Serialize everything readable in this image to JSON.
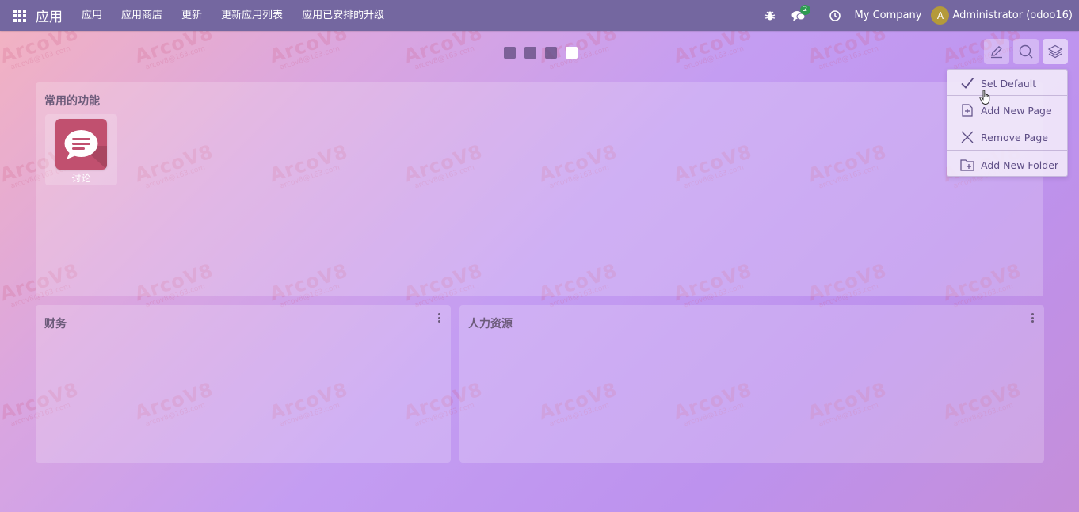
{
  "navbar": {
    "brand": "应用",
    "menu": [
      "应用",
      "应用商店",
      "更新",
      "更新应用列表",
      "应用已安排的升级"
    ],
    "messages_badge": "2",
    "company": "My Company",
    "user_initial": "A",
    "user_name": "Administrator (odoo16)"
  },
  "pager": {
    "count": 4,
    "active_index": 3
  },
  "dropdown": {
    "items": [
      {
        "label": "Set Default",
        "icon": "check-icon"
      },
      {
        "label": "Add New Page",
        "icon": "add-page-icon"
      },
      {
        "label": "Remove Page",
        "icon": "close-icon"
      },
      {
        "label": "Add New Folder",
        "icon": "add-folder-icon"
      }
    ]
  },
  "panels": {
    "favorites": {
      "title": "常用的功能",
      "apps": [
        {
          "label": "讨论",
          "icon": "discuss-chat-icon"
        }
      ]
    },
    "finance": {
      "title": "财务"
    },
    "hr": {
      "title": "人力资源"
    }
  },
  "watermark": {
    "brand": "ArcoV8",
    "email": "arcov8@163.com"
  },
  "colors": {
    "navbar": "#7467a0",
    "badge": "#2e9a52",
    "avatar": "#b49a3a",
    "discuss_icon": "#c1506f",
    "accent_text": "#5e4e86"
  }
}
